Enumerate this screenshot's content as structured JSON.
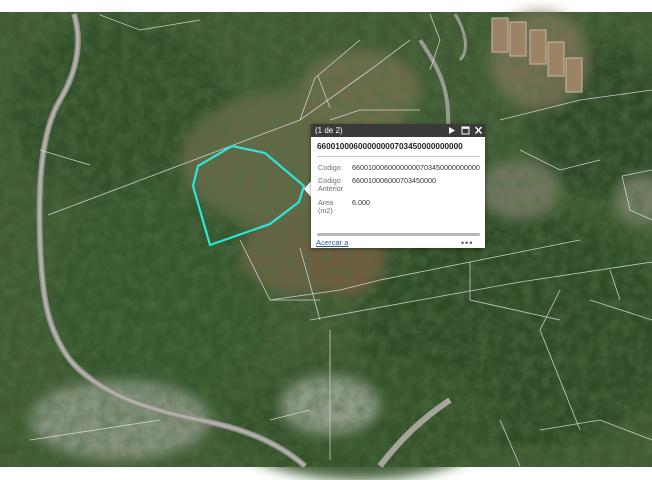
{
  "popup": {
    "count_label": "(1 de 2)",
    "title": "66001000600000000703450000000000",
    "attributes": [
      {
        "label_lines": [
          "Codigo"
        ],
        "value": "66001000600000000703450000000000"
      },
      {
        "label_lines": [
          "Codigo",
          "Anterior"
        ],
        "value": "660010006000703450000"
      },
      {
        "label_lines": [
          "Area",
          "(m2)"
        ],
        "value": "6.000"
      }
    ],
    "zoom_link": "Acercar a",
    "more_label": "•••",
    "icons": {
      "next": "play-icon",
      "maximize": "maximize-icon",
      "close": "close-icon"
    }
  },
  "map": {
    "highlight_color": "#2ee6d6",
    "parcel_line_color": "#d9d9d9"
  }
}
